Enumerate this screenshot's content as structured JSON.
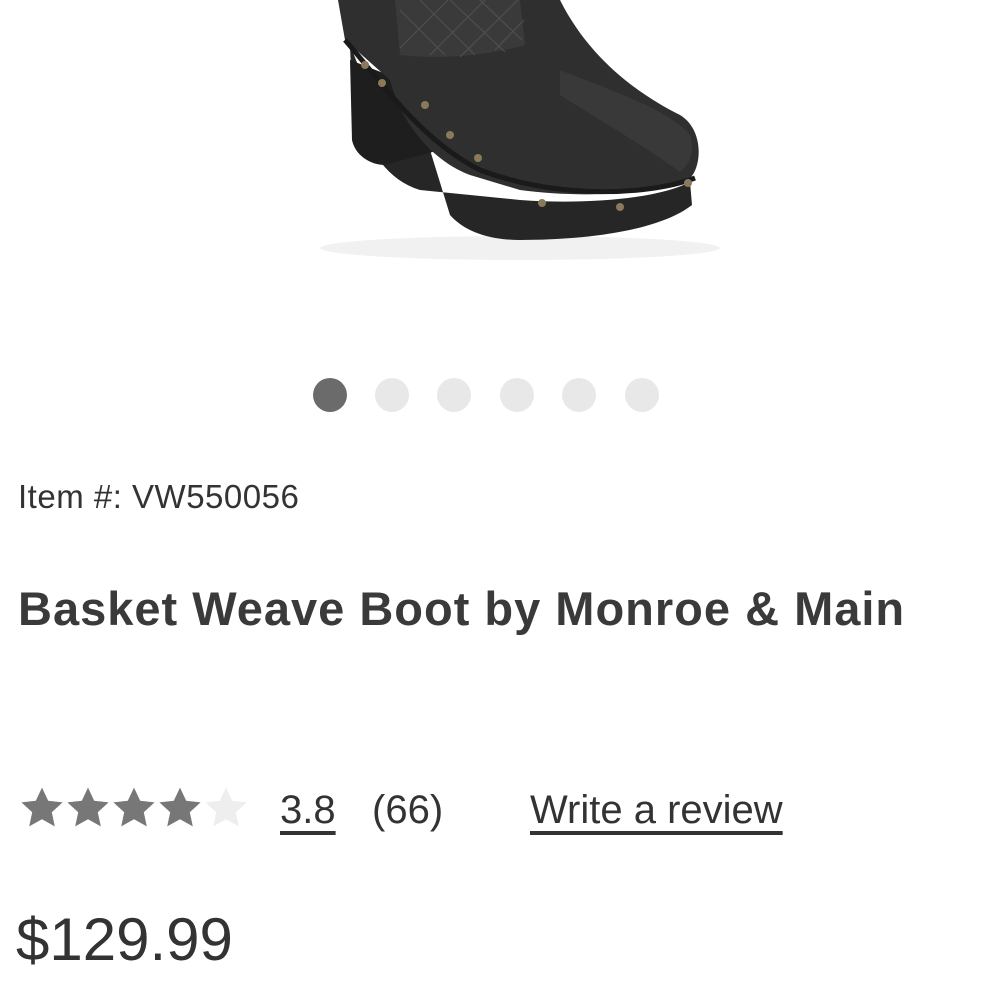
{
  "product": {
    "image_alt": "Black platform clog boot with basket weave shaft and gold studs",
    "gallery": {
      "count": 6,
      "active_index": 0
    },
    "item_prefix": "Item #:",
    "item_number": "VW550056",
    "title": "Basket Weave Boot by Monroe & Main",
    "rating": {
      "value": "3.8",
      "value_numeric": 3.8,
      "max": 5,
      "count_text": "(66)",
      "write_review_label": "Write a review"
    },
    "price": "$129.99"
  },
  "colors": {
    "dot_active": "#6b6b6b",
    "dot_inactive": "#e8e8e8",
    "star_filled": "#777777",
    "star_empty": "#eeeeee",
    "text": "#333333"
  }
}
